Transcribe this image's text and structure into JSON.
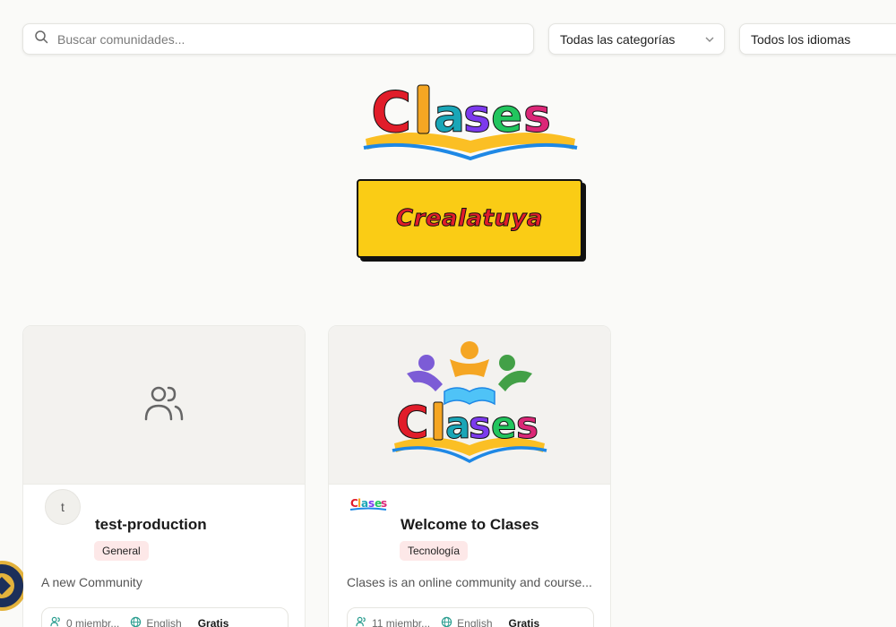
{
  "search": {
    "placeholder": "Buscar comunidades..."
  },
  "filters": {
    "category": "Todas las categorías",
    "language": "Todos los idiomas"
  },
  "hero": {
    "logo_text": "Clases",
    "cta_label": "Crealatuya"
  },
  "communities": [
    {
      "initial": "t",
      "name": "test-production",
      "category": "General",
      "description": "A new Community",
      "members": "0 miembr...",
      "language": "English",
      "price": "Gratis"
    },
    {
      "logo_text": "Clases",
      "name": "Welcome to Clases",
      "category": "Tecnología",
      "description": "Clases is an online community and course...",
      "members": "11 miembr...",
      "language": "English",
      "price": "Gratis"
    }
  ],
  "colors": {
    "cta": "#facc15",
    "cta_text": "#e11d2a",
    "tag_bg": "#fde8e8",
    "logo_c": "#e11d2a",
    "logo_l": "#f5a623",
    "logo_a": "#1aa6b7",
    "logo_s": "#7c3aed",
    "logo_e": "#22c55e",
    "logo_s2": "#db2777"
  },
  "icons": [
    "search-icon",
    "chevron-down-icon",
    "users-icon",
    "globe-icon",
    "book-icon"
  ]
}
